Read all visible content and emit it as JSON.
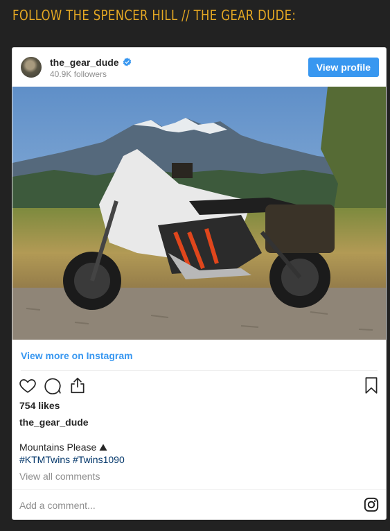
{
  "heading": "FOLLOW THE SPENCER HILL // THE GEAR DUDE:",
  "post": {
    "username": "the_gear_dude",
    "followers": "40.9K followers",
    "view_profile_label": "View profile",
    "view_more_label": "View more on Instagram",
    "likes": "754 likes",
    "caption_user": "the_gear_dude",
    "caption": "Mountains Please ⛰",
    "hashtags": "#KTMTwins #Twins1090",
    "view_comments": "View all comments",
    "add_comment_placeholder": "Add a comment..."
  },
  "colors": {
    "page_bg": "#222222",
    "heading": "#e5a823",
    "accent_blue": "#3897f0",
    "hashtag": "#003569",
    "secondary_text": "#8e8e8e"
  },
  "icons": [
    "verified-badge-icon",
    "heart-icon",
    "comment-icon",
    "share-icon",
    "bookmark-icon",
    "instagram-icon"
  ]
}
